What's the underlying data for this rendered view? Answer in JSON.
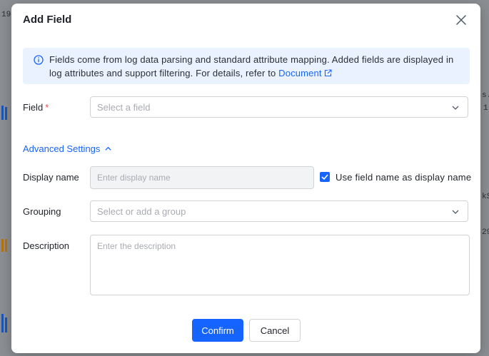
{
  "modal": {
    "title": "Add Field",
    "info": {
      "text": "Fields come from log data parsing and standard attribute mapping. Added fields are displayed in log attributes and support filtering. For details, refer to",
      "link_label": "Document"
    },
    "field": {
      "label": "Field",
      "required_mark": "*",
      "placeholder": "Select a field"
    },
    "advanced_settings_label": "Advanced Settings",
    "display_name": {
      "label": "Display name",
      "placeholder": "Enter display name",
      "checkbox_label": "Use field name as display name",
      "checkbox_checked": true
    },
    "grouping": {
      "label": "Grouping",
      "placeholder": "Select or add a group"
    },
    "description": {
      "label": "Description",
      "placeholder": "Enter the description"
    },
    "buttons": {
      "confirm": "Confirm",
      "cancel": "Cancel"
    }
  },
  "colors": {
    "primary": "#1664ff",
    "required": "#f54a45",
    "info_bg": "#eaf2ff"
  }
}
